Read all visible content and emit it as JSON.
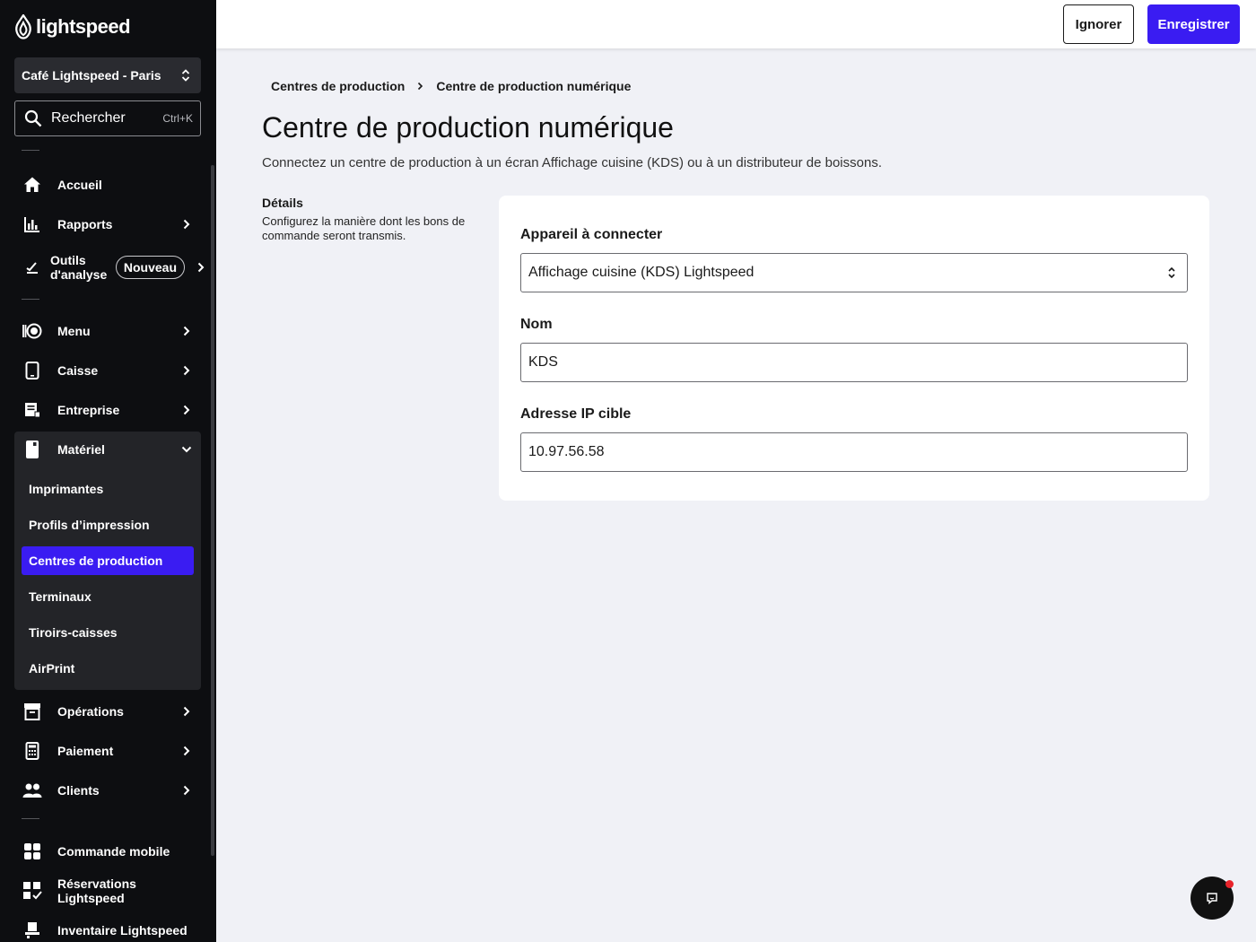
{
  "app": {
    "logo_text": "lightspeed",
    "store_name": "Café Lightspeed - Paris",
    "search": {
      "label": "Rechercher",
      "shortcut": "Ctrl+K"
    }
  },
  "sidebar": {
    "items": [
      {
        "label": "Accueil",
        "icon": "home-icon"
      },
      {
        "label": "Rapports",
        "icon": "bar-chart-icon"
      },
      {
        "label": "Outils d'analyse",
        "line1": "Outils",
        "line2": "d'analyse",
        "badge": "Nouveau",
        "icon": "analytics-icon"
      },
      {
        "label": "Menu",
        "icon": "menu-icon"
      },
      {
        "label": "Caisse",
        "icon": "tablet-icon"
      },
      {
        "label": "Entreprise",
        "icon": "business-icon"
      },
      {
        "label": "Matériel",
        "icon": "hardware-icon",
        "expanded": true
      },
      {
        "label": "Opérations",
        "icon": "archive-icon"
      },
      {
        "label": "Paiement",
        "icon": "calculator-icon"
      },
      {
        "label": "Clients",
        "icon": "users-icon"
      },
      {
        "label": "Commande mobile",
        "icon": "mobile-order-icon"
      },
      {
        "label": "Réservations Lightspeed",
        "icon": "reservations-icon"
      },
      {
        "label": "Inventaire Lightspeed",
        "icon": "inventory-icon"
      }
    ],
    "submenu": [
      {
        "label": "Imprimantes"
      },
      {
        "label": "Profils d’impression"
      },
      {
        "label": "Centres de production",
        "active": true
      },
      {
        "label": "Terminaux"
      },
      {
        "label": "Tiroirs-caisses"
      },
      {
        "label": "AirPrint"
      }
    ]
  },
  "toolbar": {
    "ignore_label": "Ignorer",
    "save_label": "Enregistrer"
  },
  "breadcrumb": {
    "parent": "Centres de production",
    "current": "Centre de production numérique"
  },
  "page": {
    "title": "Centre de production numérique",
    "subtitle": "Connectez un centre de production à un écran Affichage cuisine (KDS) ou à un distributeur de boissons."
  },
  "details": {
    "title": "Détails",
    "description": "Configurez la manière dont les bons de commande seront transmis."
  },
  "form": {
    "device_label": "Appareil à connecter",
    "device_value": "Affichage cuisine (KDS) Lightspeed",
    "name_label": "Nom",
    "name_value": "KDS",
    "ip_label": "Adresse IP cible",
    "ip_value": "10.97.56.58"
  },
  "colors": {
    "accent": "#3a1cf2",
    "sidebar_bg": "#0d0e11",
    "page_bg": "#f0f1f6",
    "notification": "#e8232a"
  }
}
